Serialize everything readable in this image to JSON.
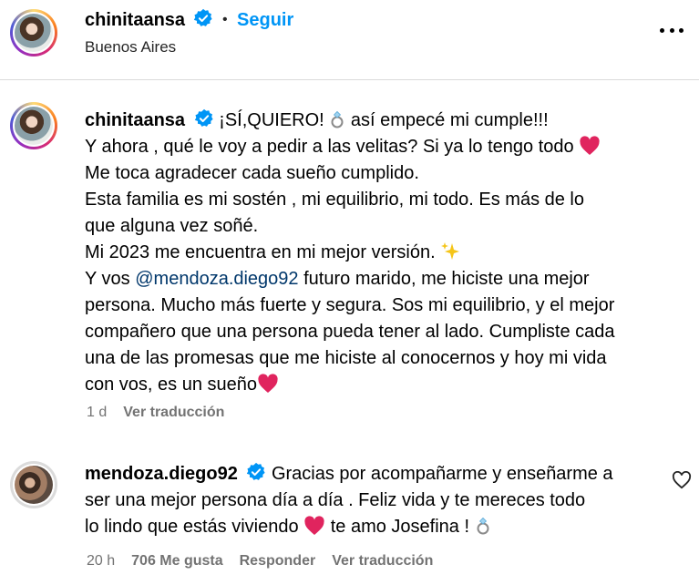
{
  "header": {
    "username": "chinitaansa",
    "separator": "•",
    "follow_label": "Seguir",
    "location": "Buenos Aires"
  },
  "caption": {
    "username": "chinitaansa",
    "line1_text_a": "¡SÍ,QUIERO!",
    "line1_text_b": "así empecé mi cumple!!!",
    "line2": "Y ahora , qué le voy a pedir a las velitas? Si ya lo tengo todo",
    "line3": "Me toca agradecer cada sueño cumplido.",
    "line4": "Esta familia es mi sostén , mi equilibrio, mi todo. Es más de lo",
    "line5": "que alguna vez soñé.",
    "line6": "Mi 2023 me encuentra en mi mejor versión.",
    "line7_pre": "Y vos",
    "line7_mention": "@mendoza.diego92",
    "line7_post": "futuro marido, me hiciste una mejor",
    "line8": "persona. Mucho más fuerte y segura. Sos mi equilibrio, y el mejor",
    "line9": "compañero que una persona pueda tener al lado. Cumpliste cada",
    "line10": "una de las promesas que me hiciste al conocernos y hoy mi vida",
    "line11": "con vos, es un sueño",
    "time": "1 d",
    "translate": "Ver traducción"
  },
  "comment": {
    "username": "mendoza.diego92",
    "line1": "Gracias por acompañarme y enseñarme a",
    "line2": "ser una mejor persona día a día . Feliz vida y te mereces todo",
    "line3_a": "lo lindo que estás viviendo",
    "line3_b": "te amo Josefina !",
    "time": "20 h",
    "likes": "706 Me gusta",
    "reply": "Responder",
    "translate": "Ver traducción"
  },
  "colors": {
    "link_blue": "#0095f6",
    "mention_blue": "#00376b",
    "muted": "#737373",
    "heart_red": "#e0245e",
    "verified_blue": "#0095f6"
  }
}
